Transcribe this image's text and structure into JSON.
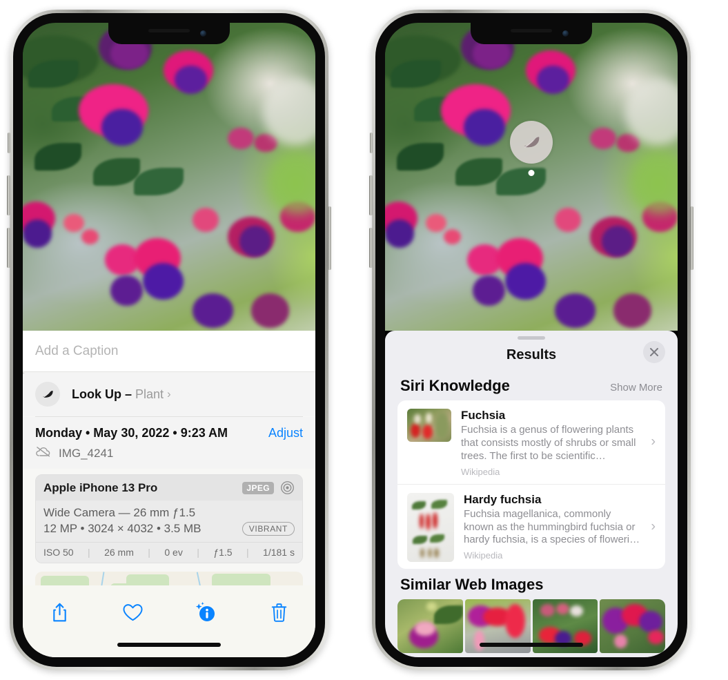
{
  "left_phone": {
    "caption_field": {
      "placeholder": "Add a Caption",
      "value": ""
    },
    "lookup": {
      "label": "Look Up",
      "dash": " – ",
      "subject": "Plant",
      "chevron": "›",
      "icon": "leaf-icon"
    },
    "date": {
      "text": "Monday • May 30, 2022 • 9:23 AM",
      "adjust_label": "Adjust"
    },
    "file": {
      "name": "IMG_4241",
      "icon": "cloud-slash-icon"
    },
    "exif": {
      "device": "Apple iPhone 13 Pro",
      "format_badge": "JPEG",
      "aperture_icon": "aperture-icon",
      "lens": "Wide Camera — 26 mm ƒ1.5",
      "size_line": "12 MP • 3024 × 4032 • 3.5 MB",
      "style_badge": "VIBRANT",
      "stats": [
        "ISO 50",
        "26 mm",
        "0 ev",
        "ƒ1.5",
        "1/181 s"
      ]
    },
    "toolbar": [
      {
        "name": "share-button",
        "icon": "share-icon"
      },
      {
        "name": "favorite-button",
        "icon": "heart-icon"
      },
      {
        "name": "info-button",
        "icon": "info-sparkle-icon"
      },
      {
        "name": "delete-button",
        "icon": "trash-icon"
      }
    ]
  },
  "right_phone": {
    "visual_lookup_badge": {
      "icon": "leaf-icon"
    },
    "sheet": {
      "title": "Results",
      "close_icon": "close-icon",
      "sections": [
        {
          "title": "Siri Knowledge",
          "action": "Show More",
          "items": [
            {
              "title": "Fuchsia",
              "description": "Fuchsia is a genus of flowering plants that consists mostly of shrubs or small trees. The first to be scientific…",
              "source": "Wikipedia",
              "chevron": "›"
            },
            {
              "title": "Hardy fuchsia",
              "description": "Fuchsia magellanica, commonly known as the hummingbird fuchsia or hardy fuchsia, is a species of floweri…",
              "source": "Wikipedia",
              "chevron": "›"
            }
          ]
        },
        {
          "title": "Similar Web Images",
          "action": "",
          "tiles": [
            "web-image-1",
            "web-image-2",
            "web-image-3",
            "web-image-4"
          ]
        }
      ]
    }
  },
  "colors": {
    "accent_blue": "#0a84ff",
    "sheet_bg": "#eeeef2",
    "card_bg": "#ffffff",
    "secondary_text": "#8e8e93",
    "panel_bg": "#f4f4f4"
  }
}
